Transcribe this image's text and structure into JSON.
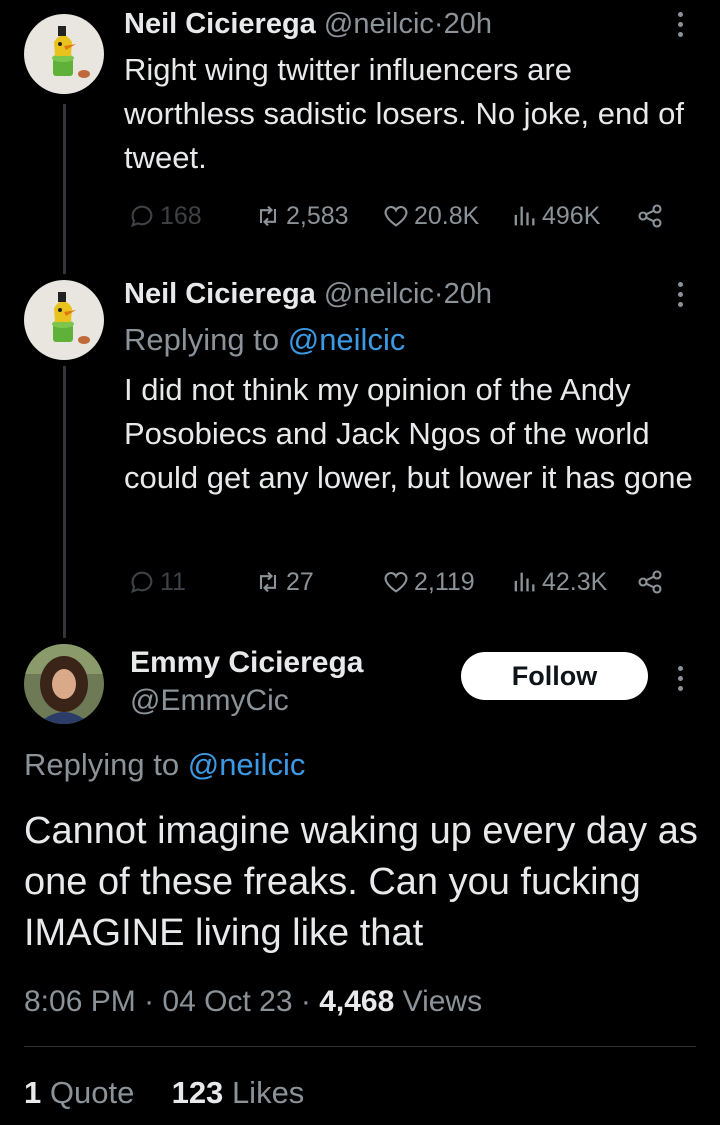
{
  "tweet1": {
    "name": "Neil Cicierega",
    "handle": "@neilcic",
    "sep": "·",
    "time": "20h",
    "text": "Right wing twitter influencers are worthless sadistic losers. No joke, end of tweet.",
    "replies": "168",
    "retweets": "2,583",
    "likes": "20.8K",
    "views": "496K"
  },
  "tweet2": {
    "name": "Neil Cicierega",
    "handle": "@neilcic",
    "sep": "·",
    "time": "20h",
    "reply_prefix": "Replying to",
    "reply_mention": "@neilcic",
    "text": "I did not think my opinion of the Andy Posobiecs and Jack Ngos of the world could get any lower, but lower it has gone",
    "replies": "11",
    "retweets": "27",
    "likes": "2,119",
    "views": "42.3K"
  },
  "main": {
    "name": "Emmy Cicierega",
    "handle": "@EmmyCic",
    "follow_label": "Follow",
    "reply_prefix": "Replying to",
    "reply_mention": "@neilcic",
    "text": "Cannot imagine waking up every day as one of these freaks. Can you fucking IMAGINE living like that",
    "time": "8:06 PM",
    "sep": "·",
    "date": "04 Oct 23",
    "views_count": "4,468",
    "views_label": "Views",
    "quotes_count": "1",
    "quotes_label": "Quote",
    "likes_count": "123",
    "likes_label": "Likes"
  },
  "colors": {
    "background": "#000000",
    "text": "#e7e9ea",
    "secondary": "#8b9298",
    "link": "#3b9ae3",
    "divider": "#2f3336"
  },
  "icons": [
    "reply-icon",
    "retweet-icon",
    "like-icon",
    "views-icon",
    "share-icon",
    "more-icon"
  ]
}
